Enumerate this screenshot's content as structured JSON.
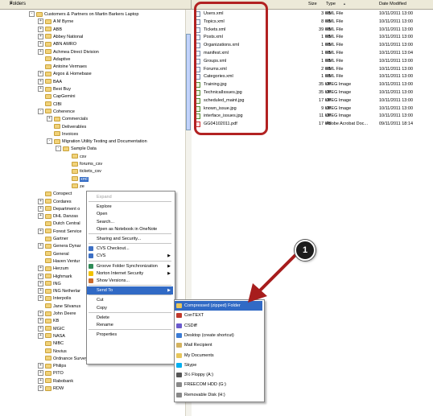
{
  "folders_pane": {
    "title": "Folders",
    "close_glyph": "×",
    "tree": [
      {
        "label": "Customers & Partners on Martin Barkers Laptop",
        "indent": 0,
        "pm": "-"
      },
      {
        "label": "A M Byrne",
        "indent": 1,
        "pm": "+"
      },
      {
        "label": "ABB",
        "indent": 1,
        "pm": "+"
      },
      {
        "label": "Abbey National",
        "indent": 1,
        "pm": "+"
      },
      {
        "label": "ABN AMRO",
        "indent": 1,
        "pm": "+"
      },
      {
        "label": "Achmea Direct Division",
        "indent": 1,
        "pm": "+"
      },
      {
        "label": "Adaptive",
        "indent": 1,
        "pm": ""
      },
      {
        "label": "Antoine Vermaes",
        "indent": 1,
        "pm": ""
      },
      {
        "label": "Argos & Homebase",
        "indent": 1,
        "pm": "+"
      },
      {
        "label": "BAA",
        "indent": 1,
        "pm": "+"
      },
      {
        "label": "Best Buy",
        "indent": 1,
        "pm": "+"
      },
      {
        "label": "CapGemini",
        "indent": 1,
        "pm": ""
      },
      {
        "label": "CIBI",
        "indent": 1,
        "pm": ""
      },
      {
        "label": "Coherence",
        "indent": 1,
        "pm": "-"
      },
      {
        "label": "Commercials",
        "indent": 2,
        "pm": "+"
      },
      {
        "label": "Deliverables",
        "indent": 2,
        "pm": ""
      },
      {
        "label": "Invoices",
        "indent": 2,
        "pm": ""
      },
      {
        "label": "Migration Utility Testing and Documentation",
        "indent": 2,
        "pm": "-"
      },
      {
        "label": "Sample Data",
        "indent": 3,
        "pm": "-"
      },
      {
        "label": "csv",
        "indent": 4,
        "pm": ""
      },
      {
        "label": "forums_csv",
        "indent": 4,
        "pm": ""
      },
      {
        "label": "tickets_csv",
        "indent": 4,
        "pm": ""
      },
      {
        "label": "xml",
        "indent": 4,
        "pm": "",
        "selected": true
      },
      {
        "label": "ze",
        "indent": 4,
        "pm": ""
      },
      {
        "label": "Conspect",
        "indent": 1,
        "pm": ""
      },
      {
        "label": "Cordares",
        "indent": 1,
        "pm": "+"
      },
      {
        "label": "Department o",
        "indent": 1,
        "pm": "+"
      },
      {
        "label": "DHL Danzas",
        "indent": 1,
        "pm": "+"
      },
      {
        "label": "Dutch Central",
        "indent": 1,
        "pm": ""
      },
      {
        "label": "Forest Service",
        "indent": 1,
        "pm": "+"
      },
      {
        "label": "Gartner",
        "indent": 1,
        "pm": ""
      },
      {
        "label": "Genera Dynar",
        "indent": 1,
        "pm": "+"
      },
      {
        "label": "General",
        "indent": 1,
        "pm": ""
      },
      {
        "label": "Haven Ventur",
        "indent": 1,
        "pm": ""
      },
      {
        "label": "Herzum",
        "indent": 1,
        "pm": "+"
      },
      {
        "label": "Highmark",
        "indent": 1,
        "pm": "+"
      },
      {
        "label": "ING",
        "indent": 1,
        "pm": "+"
      },
      {
        "label": "ING Netherlar",
        "indent": 1,
        "pm": "+"
      },
      {
        "label": "Interpolis",
        "indent": 1,
        "pm": "+"
      },
      {
        "label": "Jane Silvanus",
        "indent": 1,
        "pm": ""
      },
      {
        "label": "John Deere",
        "indent": 1,
        "pm": "+"
      },
      {
        "label": "KB",
        "indent": 1,
        "pm": "+"
      },
      {
        "label": "MGIC",
        "indent": 1,
        "pm": "+"
      },
      {
        "label": "NASA",
        "indent": 1,
        "pm": "+"
      },
      {
        "label": "NIBC",
        "indent": 1,
        "pm": ""
      },
      {
        "label": "Novius",
        "indent": 1,
        "pm": ""
      },
      {
        "label": "Ordnance Survey",
        "indent": 1,
        "pm": ""
      },
      {
        "label": "Philips",
        "indent": 1,
        "pm": "+"
      },
      {
        "label": "PITO",
        "indent": 1,
        "pm": "+"
      },
      {
        "label": "Rabobank",
        "indent": 1,
        "pm": "+"
      },
      {
        "label": "RDW",
        "indent": 1,
        "pm": "+"
      }
    ]
  },
  "files_pane": {
    "columns": {
      "size": "Size",
      "type": "Type",
      "modified": "Date Modified"
    },
    "sort_glyph": "▲",
    "files": [
      {
        "name": "Users.xml",
        "size": "3 KB",
        "type": "XML File",
        "date": "10/11/2011 13:00",
        "kind": "xml"
      },
      {
        "name": "Topics.xml",
        "size": "8 KB",
        "type": "XML File",
        "date": "10/11/2011 13:00",
        "kind": "xml"
      },
      {
        "name": "Tickets.xml",
        "size": "39 KB",
        "type": "XML File",
        "date": "10/11/2011 13:00",
        "kind": "xml"
      },
      {
        "name": "Posts.xml",
        "size": "1 KB",
        "type": "XML File",
        "date": "10/11/2011 13:00",
        "kind": "xml"
      },
      {
        "name": "Organizations.xml",
        "size": "1 KB",
        "type": "XML File",
        "date": "10/11/2011 13:00",
        "kind": "xml"
      },
      {
        "name": "manifest.xml",
        "size": "1 KB",
        "type": "XML File",
        "date": "10/11/2011 13:04",
        "kind": "xml"
      },
      {
        "name": "Groups.xml",
        "size": "1 KB",
        "type": "XML File",
        "date": "10/11/2011 13:00",
        "kind": "xml"
      },
      {
        "name": "Forums.xml",
        "size": "2 KB",
        "type": "XML File",
        "date": "10/11/2011 13:00",
        "kind": "xml"
      },
      {
        "name": "Categories.xml",
        "size": "1 KB",
        "type": "XML File",
        "date": "10/11/2011 13:00",
        "kind": "xml"
      },
      {
        "name": "Training.jpg",
        "size": "35 KB",
        "type": "JPEG Image",
        "date": "10/11/2011 13:00",
        "kind": "jpg"
      },
      {
        "name": "TechnicalIssues.jpg",
        "size": "35 KB",
        "type": "JPEG Image",
        "date": "10/11/2011 13:00",
        "kind": "jpg"
      },
      {
        "name": "scheduled_maint.jpg",
        "size": "17 KB",
        "type": "JPEG Image",
        "date": "10/11/2011 13:00",
        "kind": "jpg"
      },
      {
        "name": "known_issue.jpg",
        "size": "9 KB",
        "type": "JPEG Image",
        "date": "10/11/2011 13:00",
        "kind": "jpg"
      },
      {
        "name": "interface_issues.jpg",
        "size": "11 KB",
        "type": "JPEG Image",
        "date": "10/11/2011 13:00",
        "kind": "jpg"
      },
      {
        "name": "GG04102011.pdf",
        "size": "17 KB",
        "type": "Adobe Acrobat Doc...",
        "date": "09/11/2011 18:14",
        "kind": "pdf"
      }
    ]
  },
  "context_menu": {
    "items": [
      {
        "label": "Expand",
        "disabled": true,
        "icon": ""
      },
      {
        "sep": true
      },
      {
        "label": "Explore",
        "icon": ""
      },
      {
        "label": "Open",
        "icon": ""
      },
      {
        "label": "Search...",
        "icon": ""
      },
      {
        "label": "Open as Notebook in OneNote",
        "icon": ""
      },
      {
        "sep": true
      },
      {
        "label": "Sharing and Security...",
        "icon": ""
      },
      {
        "sep": true
      },
      {
        "label": "CVS Checkout...",
        "icon": "cvs-icon"
      },
      {
        "label": "CVS",
        "arrow": true,
        "icon": "cvs-icon"
      },
      {
        "sep": true
      },
      {
        "label": "Groove Folder Synchronization",
        "arrow": true,
        "icon": "groove-icon"
      },
      {
        "label": "Norton Internet Security",
        "arrow": true,
        "icon": "norton-icon"
      },
      {
        "label": "Show Versions...",
        "icon": "versions-icon"
      },
      {
        "sep": true
      },
      {
        "label": "Send To",
        "arrow": true,
        "highlighted": true,
        "icon": ""
      },
      {
        "sep": true
      },
      {
        "label": "Cut",
        "icon": ""
      },
      {
        "label": "Copy",
        "icon": ""
      },
      {
        "sep": true
      },
      {
        "label": "Delete",
        "icon": ""
      },
      {
        "label": "Rename",
        "icon": ""
      },
      {
        "sep": true
      },
      {
        "label": "Properties",
        "icon": ""
      }
    ],
    "arrow_glyph": "▶"
  },
  "send_to_menu": {
    "items": [
      {
        "label": "Compressed (zipped) Folder",
        "highlighted": true,
        "icon": "zip-folder-icon",
        "color": "#e8c65a"
      },
      {
        "label": "ConTEXT",
        "icon": "context-editor-icon",
        "color": "#c0392b"
      },
      {
        "label": "CSDiff",
        "icon": "csdiff-icon",
        "color": "#6a5acd"
      },
      {
        "label": "Desktop (create shortcut)",
        "icon": "desktop-icon",
        "color": "#3a7bd5"
      },
      {
        "label": "Mail Recipient",
        "icon": "mail-icon",
        "color": "#d4b25e"
      },
      {
        "label": "My Documents",
        "icon": "my-documents-icon",
        "color": "#e8c65a"
      },
      {
        "label": "Skype",
        "icon": "skype-icon",
        "color": "#00aff0"
      },
      {
        "label": "3½ Floppy (A:)",
        "icon": "floppy-icon",
        "color": "#555555"
      },
      {
        "label": "FREECOM HDD (G:)",
        "icon": "hard-drive-icon",
        "color": "#888888"
      },
      {
        "label": "Removable Disk (H:)",
        "icon": "removable-disk-icon",
        "color": "#888888"
      }
    ]
  },
  "annotation": {
    "callout_number": "1",
    "highlight_color": "#b22222"
  }
}
